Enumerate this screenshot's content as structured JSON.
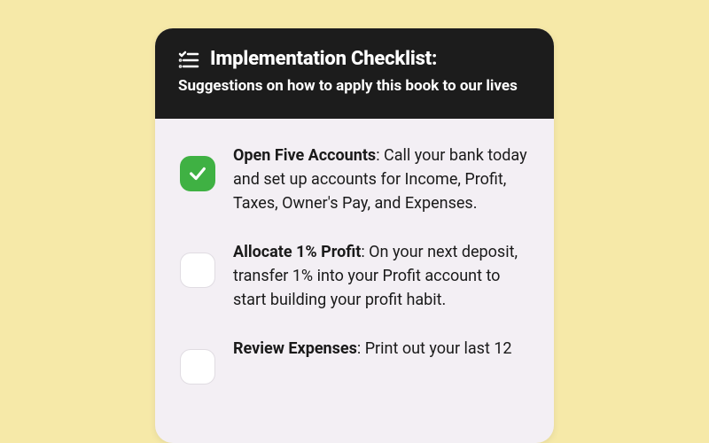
{
  "header": {
    "title": "Implementation Checklist:",
    "subtitle": "Suggestions on how to apply this book to our lives"
  },
  "items": [
    {
      "checked": true,
      "title": "Open Five Accounts",
      "body": ": Call your bank today and set up accounts for Income, Profit, Taxes, Owner's Pay, and Expenses."
    },
    {
      "checked": false,
      "title": "Allocate 1% Profit",
      "body": ": On your next deposit, transfer 1% into your Profit account to start building your profit habit."
    },
    {
      "checked": false,
      "title": "Review Expenses",
      "body": ": Print out your last 12"
    }
  ]
}
